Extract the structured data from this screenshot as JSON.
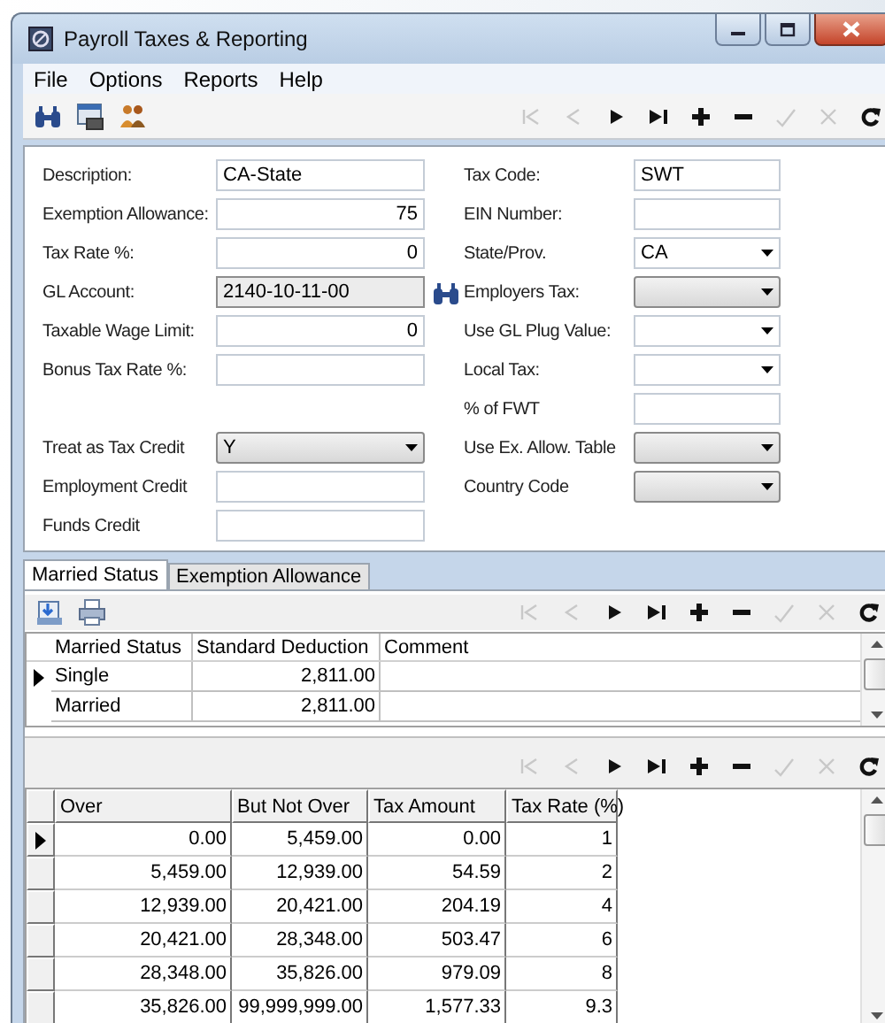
{
  "window": {
    "title": "Payroll Taxes & Reporting"
  },
  "menu": [
    "File",
    "Options",
    "Reports",
    "Help"
  ],
  "toolbar": {
    "tools": [
      {
        "kind": "find"
      },
      {
        "kind": "form"
      },
      {
        "kind": "people"
      }
    ],
    "navigator": [
      {
        "kind": "first",
        "disabled": true
      },
      {
        "kind": "prior",
        "disabled": true
      },
      {
        "kind": "next",
        "disabled": false
      },
      {
        "kind": "last",
        "disabled": false
      },
      {
        "kind": "insert",
        "disabled": false
      },
      {
        "kind": "delete",
        "disabled": false
      },
      {
        "kind": "post",
        "disabled": true
      },
      {
        "kind": "cancel",
        "disabled": true
      },
      {
        "kind": "refresh",
        "disabled": false
      }
    ]
  },
  "form": {
    "rows": [
      {
        "left": {
          "label": "Description:",
          "kind": "text",
          "value": "CA-State"
        },
        "right": {
          "label": "Tax Code:",
          "kind": "text",
          "value": "SWT"
        }
      },
      {
        "left": {
          "label": "Exemption Allowance:",
          "kind": "number",
          "value": "75"
        },
        "right": {
          "label": "EIN Number:",
          "kind": "text"
        }
      },
      {
        "left": {
          "label": "Tax Rate %:",
          "kind": "number",
          "value": "0"
        },
        "right": {
          "label": "State/Prov.",
          "kind": "dropdown",
          "disabled": false,
          "value": "CA"
        }
      },
      {
        "left": {
          "label": "GL Account:",
          "kind": "lookup",
          "value": "2140-10-11-00"
        },
        "right": {
          "label": "Employers Tax:",
          "kind": "dropdown",
          "disabled": true
        }
      },
      {
        "left": {
          "label": "Taxable Wage Limit:",
          "kind": "number",
          "value": "0"
        },
        "right": {
          "label": "Use GL Plug Value:",
          "kind": "dropdown",
          "disabled": false
        }
      },
      {
        "left": {
          "label": "Bonus Tax Rate %:",
          "kind": "text"
        },
        "right": {
          "label": "Local Tax:",
          "kind": "dropdown",
          "disabled": false
        }
      },
      {
        "right": {
          "label": "% of FWT",
          "kind": "text"
        }
      },
      {
        "left": {
          "label": "Treat as Tax Credit",
          "kind": "dropdown",
          "disabled": true,
          "value": "Y"
        },
        "right": {
          "label": "Use Ex. Allow. Table",
          "kind": "dropdown",
          "disabled": true
        }
      },
      {
        "left": {
          "label": "Employment Credit",
          "kind": "text"
        },
        "right": {
          "label": "Country Code",
          "kind": "dropdown",
          "disabled": true
        }
      },
      {
        "left": {
          "label": "Funds Credit",
          "kind": "text"
        }
      }
    ]
  },
  "tabs": [
    {
      "label": "Married Status",
      "selected": true
    },
    {
      "label": "Exemption Allowance",
      "selected": false
    }
  ],
  "status_grid": {
    "tools": [
      {
        "kind": "import"
      },
      {
        "kind": "export"
      }
    ],
    "navigator": [
      {
        "kind": "first",
        "disabled": true
      },
      {
        "kind": "prior",
        "disabled": true
      },
      {
        "kind": "next",
        "disabled": false
      },
      {
        "kind": "last",
        "disabled": false
      },
      {
        "kind": "insert",
        "disabled": false
      },
      {
        "kind": "delete",
        "disabled": false
      },
      {
        "kind": "post",
        "disabled": true
      },
      {
        "kind": "cancel",
        "disabled": true
      },
      {
        "kind": "refresh",
        "disabled": false
      }
    ],
    "columns": [
      "Married Status",
      "Standard Deduction",
      "Comment"
    ],
    "rows": [
      {
        "selected": true,
        "cells": [
          "Single",
          "2,811.00"
        ]
      },
      {
        "selected": false,
        "cells": [
          "Married",
          "2,811.00"
        ]
      }
    ]
  },
  "bracket_grid": {
    "navigator": [
      {
        "kind": "first",
        "disabled": true
      },
      {
        "kind": "prior",
        "disabled": true
      },
      {
        "kind": "next",
        "disabled": false
      },
      {
        "kind": "last",
        "disabled": false
      },
      {
        "kind": "insert",
        "disabled": false
      },
      {
        "kind": "delete",
        "disabled": false
      },
      {
        "kind": "post",
        "disabled": true
      },
      {
        "kind": "cancel",
        "disabled": true
      },
      {
        "kind": "refresh",
        "disabled": false
      }
    ],
    "columns": [
      "Over",
      "But Not Over",
      "Tax Amount",
      "Tax Rate (%)"
    ],
    "rows": [
      {
        "selected": true,
        "cells": [
          "0.00",
          "5,459.00",
          "0.00",
          "1"
        ]
      },
      {
        "selected": false,
        "cells": [
          "5,459.00",
          "12,939.00",
          "54.59",
          "2"
        ]
      },
      {
        "selected": false,
        "cells": [
          "12,939.00",
          "20,421.00",
          "204.19",
          "4"
        ]
      },
      {
        "selected": false,
        "cells": [
          "20,421.00",
          "28,348.00",
          "503.47",
          "6"
        ]
      },
      {
        "selected": false,
        "cells": [
          "28,348.00",
          "35,826.00",
          "979.09",
          "8"
        ]
      },
      {
        "selected": false,
        "cells": [
          "35,826.00",
          "99,999,999.00",
          "1,577.33",
          "9.3"
        ]
      }
    ]
  }
}
